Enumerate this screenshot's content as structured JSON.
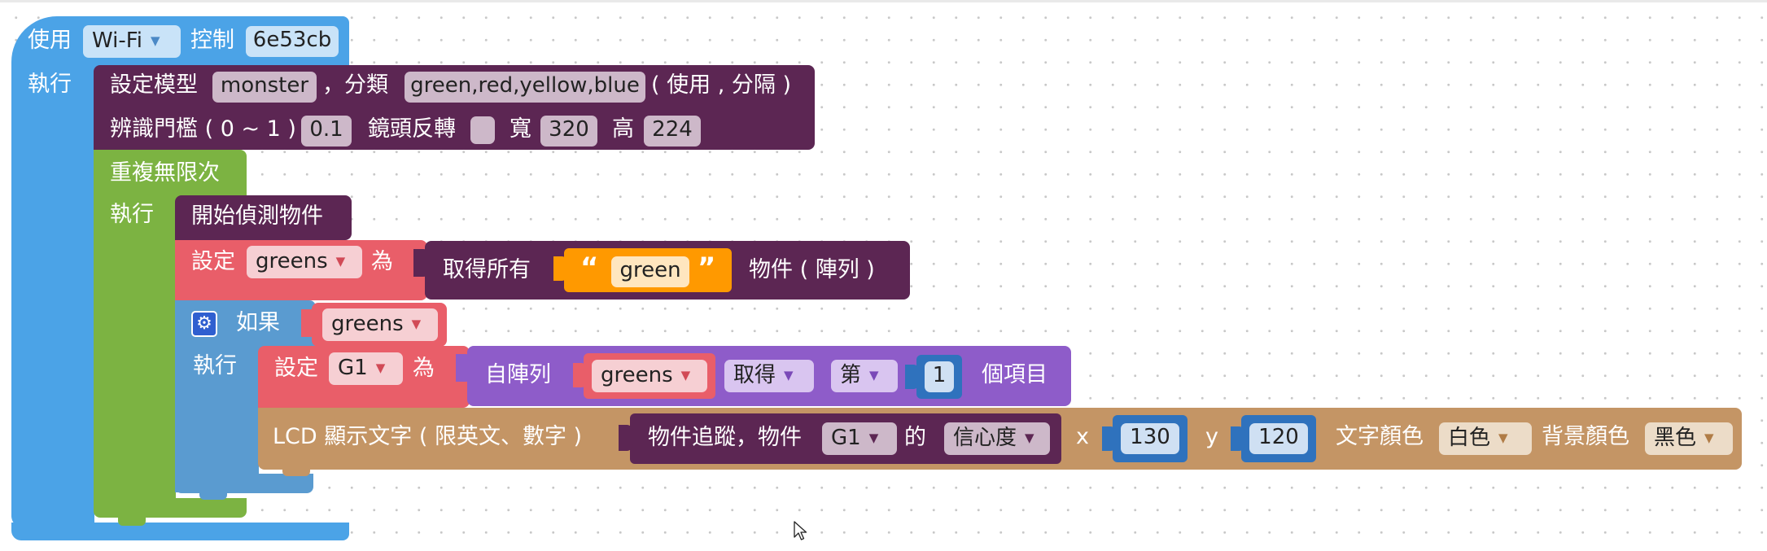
{
  "colors": {
    "connection": "#4ba3e7",
    "purple": "#5c2653",
    "loop": "#7cb342",
    "variable": "#e95e69",
    "logic": "#5a9bd0",
    "list": "#8e5cc9",
    "text": "#ff9900",
    "math": "#2f72bd",
    "lcd": "#c49565"
  },
  "blocks": {
    "wifi": {
      "use": "使用",
      "connection": "Wi-Fi",
      "control": "控制",
      "device_id": "6e53cb",
      "exec": "執行"
    },
    "model": {
      "set_model": "設定模型",
      "model_name": "monster",
      "classify": "，分類",
      "classes": "green,red,yellow,blue",
      "classes_note": "( 使用 , 分隔 )",
      "threshold_label": "辨識門檻 ( 0 ~ 1 )",
      "threshold": "0.1",
      "mirror_label": "鏡頭反轉",
      "width_label": "寬",
      "width": "320",
      "height_label": "高",
      "height": "224"
    },
    "loop": {
      "repeat": "重複無限次",
      "exec": "執行"
    },
    "detect": {
      "label": "開始偵測物件"
    },
    "set_greens": {
      "set": "設定",
      "var": "greens",
      "as": "為"
    },
    "get_all": {
      "label": "取得所有",
      "quote_open": "“",
      "text": "green",
      "quote_close": "”",
      "suffix": "物件 ( 陣列 )"
    },
    "if": {
      "label": "如果",
      "var": "greens",
      "exec": "執行"
    },
    "set_g1": {
      "set": "設定",
      "var": "G1",
      "as": "為"
    },
    "list_get": {
      "from": "自陣列",
      "list_var": "greens",
      "get": "取得",
      "nth": "第",
      "index": "1",
      "item": "個項目"
    },
    "lcd": {
      "label": "LCD 顯示文字 ( 限英文、數字 )",
      "track": "物件追蹤，物件",
      "obj": "G1",
      "of": "的",
      "prop": "信心度",
      "x_label": "x",
      "x": "130",
      "y_label": "y",
      "y": "120",
      "text_color_label": "文字顏色",
      "text_color": "白色",
      "bg_color_label": "背景顏色",
      "bg_color": "黑色"
    }
  }
}
